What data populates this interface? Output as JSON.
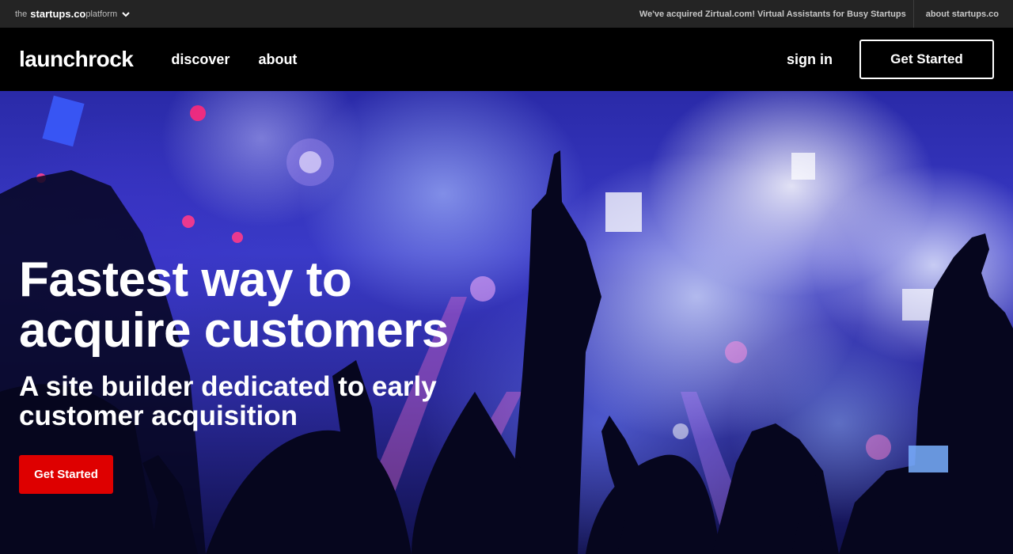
{
  "platform_bar": {
    "prefix": "the",
    "brand": "startups.co",
    "suffix": "platform",
    "promo": "We've acquired Zirtual.com! Virtual Assistants for Busy Startups",
    "about": "about startups.co"
  },
  "nav": {
    "logo": "launchrock",
    "links": [
      "discover",
      "about"
    ],
    "sign_in": "sign in",
    "cta": "Get Started"
  },
  "hero": {
    "title_line1": "Fastest way to",
    "title_line2": "acquire customers",
    "subtitle": "A site builder dedicated to early customer acquisition",
    "cta": "Get Started"
  },
  "colors": {
    "platform_bar_bg": "#242424",
    "nav_bg": "#000000",
    "cta_red": "#de0000"
  }
}
